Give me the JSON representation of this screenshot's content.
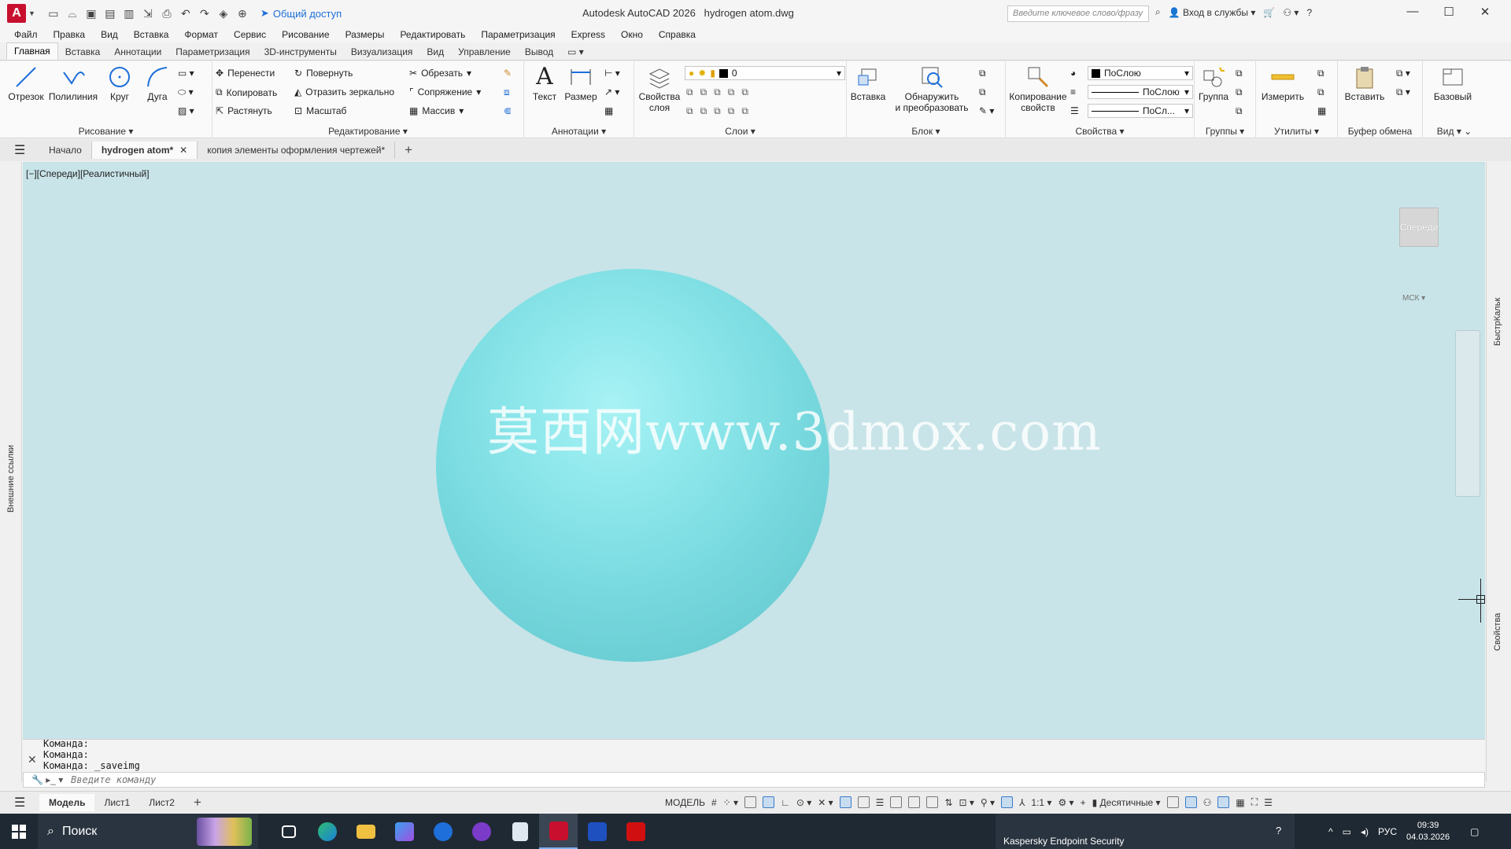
{
  "titlebar": {
    "share_label": "Общий доступ",
    "app_name": "Autodesk AutoCAD 2026",
    "file_name": "hydrogen atom.dwg",
    "search_placeholder": "Введите ключевое слово/фразу",
    "signin_label": "Вход в службы",
    "help_label": "?"
  },
  "menu": [
    "Файл",
    "Правка",
    "Вид",
    "Вставка",
    "Формат",
    "Сервис",
    "Рисование",
    "Размеры",
    "Редактировать",
    "Параметризация",
    "Express",
    "Окно",
    "Справка"
  ],
  "ribbon_tabs": [
    "Главная",
    "Вставка",
    "Аннотации",
    "Параметризация",
    "3D-инструменты",
    "Визуализация",
    "Вид",
    "Управление",
    "Вывод"
  ],
  "ribbon": {
    "draw": {
      "title": "Рисование",
      "line": "Отрезок",
      "polyline": "Полилиния",
      "circle": "Круг",
      "arc": "Дуга"
    },
    "modify": {
      "title": "Редактирование",
      "move": "Перенести",
      "rotate": "Повернуть",
      "trim": "Обрезать",
      "copy": "Копировать",
      "mirror": "Отразить зеркально",
      "fillet": "Сопряжение",
      "stretch": "Растянуть",
      "scale": "Масштаб",
      "array": "Массив"
    },
    "annotation": {
      "title": "Аннотации",
      "text": "Текст",
      "dimension": "Размер"
    },
    "layers": {
      "title": "Слои",
      "layer_props_1": "Свойства",
      "layer_props_2": "слоя",
      "current_layer": "0"
    },
    "block": {
      "title": "Блок",
      "insert": "Вставка",
      "detect_1": "Обнаружить",
      "detect_2": "и преобразовать"
    },
    "properties": {
      "title": "Свойства",
      "match_1": "Копирование",
      "match_2": "свойств",
      "color": "ПоСлою",
      "linetype": "ПоСлою",
      "lineweight": "ПоСл..."
    },
    "groups": {
      "title": "Группы",
      "group": "Группа"
    },
    "utilities": {
      "title": "Утилиты",
      "measure": "Измерить"
    },
    "clipboard": {
      "title": "Буфер обмена",
      "paste": "Вставить"
    },
    "view": {
      "title": "Вид",
      "base": "Базовый"
    }
  },
  "doc_tabs": {
    "start": "Начало",
    "active": "hydrogen atom*",
    "other": "копия элементы оформления чертежей*"
  },
  "side_panels": {
    "left": "Внешние ссылки",
    "right_top": "БыстрКальк",
    "right_bottom": "Свойства"
  },
  "viewport": {
    "label": "[−][Спереди][Реалистичный]",
    "viewcube": "Спереди",
    "wcs": "МСК",
    "watermark": "莫西网www.3dmox.com"
  },
  "command": {
    "history": [
      "Команда:",
      "Команда:",
      "Команда: _saveimg"
    ],
    "placeholder": "Введите команду"
  },
  "layout_tabs": [
    "Модель",
    "Лист1",
    "Лист2"
  ],
  "statusbar": {
    "mode": "МОДЕЛЬ",
    "scale": "1:1",
    "units": "Десятичные"
  },
  "taskbar": {
    "search": "Поиск",
    "kaspersky": "Kaspersky Endpoint Security",
    "lang": "РУС",
    "time": "09:39",
    "date": "04.03.2026"
  }
}
